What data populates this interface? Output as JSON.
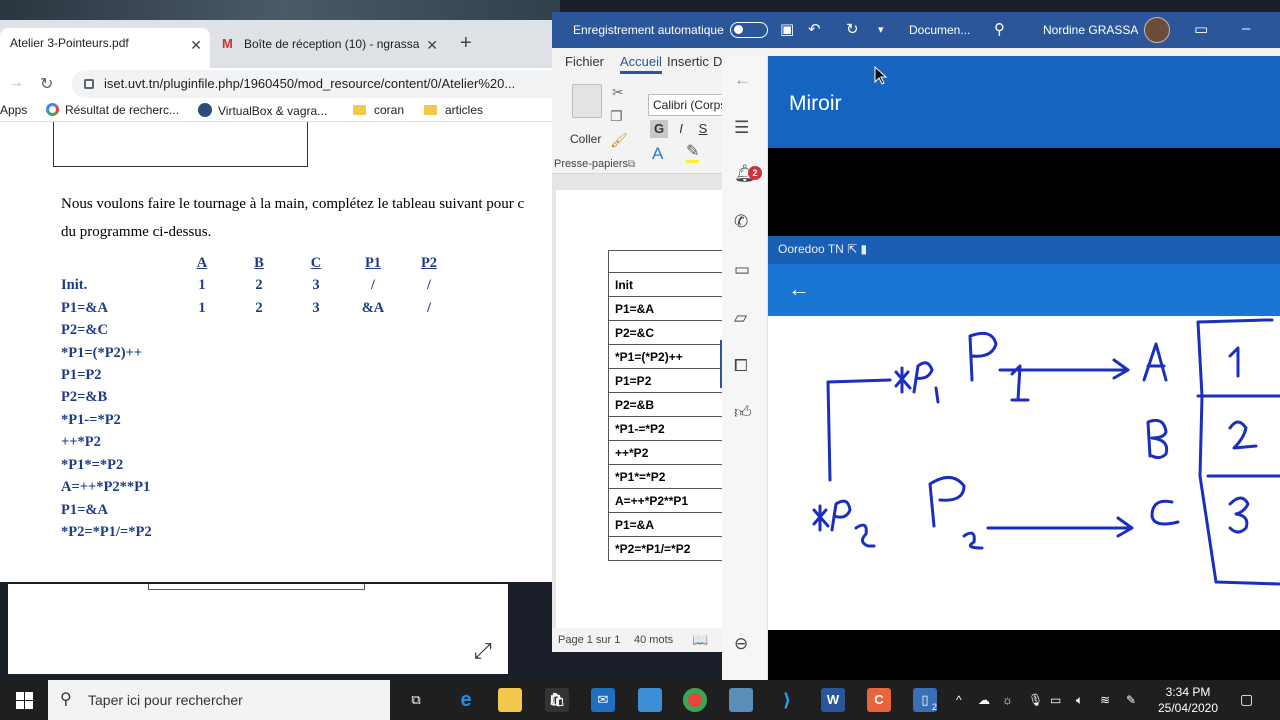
{
  "chrome": {
    "tabs": [
      {
        "title": "Atelier 3-Pointeurs.pdf"
      },
      {
        "title": "Boîte de réception (10) - ngrassa"
      }
    ],
    "url": "iset.uvt.tn/pluginfile.php/1960450/mod_resource/content/0/Atelier%20...",
    "bookmarks": [
      "Apps",
      "Résultat de recherc...",
      "VirtualBox & vagra...",
      "coran",
      "articles"
    ]
  },
  "pdf": {
    "paragraph_line1": "Nous voulons faire le tournage à la main, complétez le tableau suivant pour c",
    "paragraph_line2": "du programme ci-dessus.",
    "columns": [
      "A",
      "B",
      "C",
      "P1",
      "P2"
    ],
    "rows": [
      {
        "label": "Init.",
        "values": [
          "1",
          "2",
          "3",
          "/",
          "/"
        ]
      },
      {
        "label": "P1=&A",
        "values": [
          "1",
          "2",
          "3",
          "&A",
          "/"
        ]
      },
      {
        "label": "P2=&C",
        "values": []
      },
      {
        "label": "*P1=(*P2)++",
        "values": []
      },
      {
        "label": "P1=P2",
        "values": []
      },
      {
        "label": "P2=&B",
        "values": []
      },
      {
        "label": "*P1-=*P2",
        "values": []
      },
      {
        "label": "++*P2",
        "values": []
      },
      {
        "label": "*P1*=*P2",
        "values": []
      },
      {
        "label": "A=++*P2**P1",
        "values": []
      },
      {
        "label": "P1=&A",
        "values": []
      },
      {
        "label": "*P2=*P1/=*P2",
        "values": []
      }
    ]
  },
  "word": {
    "autosave_label": "Enregistrement automatique",
    "doc_title": "Documen...",
    "user_name": "Nordine GRASSA",
    "tabs": [
      "Fichier",
      "Accueil",
      "Insertic",
      "D"
    ],
    "paste_label": "Coller",
    "font_name": "Calibri (Corps",
    "bold": "G",
    "italic": "I",
    "underline": "S",
    "group_label": "Presse-papiers",
    "table_rows": [
      "",
      "Init",
      "P1=&A",
      "P2=&C",
      "*P1=(*P2)++",
      "P1=P2",
      "P2=&B",
      "*P1-=*P2",
      "++*P2",
      "*P1*=*P2",
      "A=++*P2**P1",
      "P1=&A",
      "*P2=*P1/=*P2"
    ],
    "status_page": "Page 1 sur 1",
    "status_words": "40 mots"
  },
  "mirror": {
    "title": "Miroir",
    "notification_count": "2",
    "carrier": "Ooredoo TN"
  },
  "taskbar": {
    "search_placeholder": "Taper ici pour rechercher",
    "time": "3:34 PM",
    "date": "25/04/2020",
    "phone_badge": "2"
  }
}
